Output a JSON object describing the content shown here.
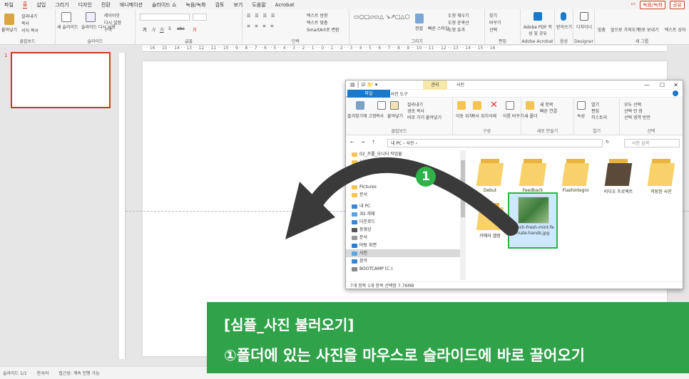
{
  "menu": {
    "items": [
      "파일",
      "홈",
      "삽입",
      "그리기",
      "디자인",
      "전환",
      "애니메이션",
      "슬라이드 쇼",
      "녹음/녹화",
      "검토",
      "보기",
      "도움말",
      "Acrobat"
    ],
    "record_label": "녹음/녹화",
    "share_label": "공유"
  },
  "ribbon": {
    "groups": [
      {
        "label": "클립보드",
        "items": [
          "붙여넣기",
          "잘라내기",
          "복사",
          "서식 복사"
        ]
      },
      {
        "label": "슬라이드",
        "items": [
          "새 슬라이드",
          "슬라이드 다시 사용",
          "레이아웃",
          "다시 설정",
          "구역"
        ]
      },
      {
        "label": "글꼴",
        "items": [
          "가",
          "가",
          "가",
          "S",
          "abc",
          "가"
        ]
      },
      {
        "label": "단락",
        "items": [
          "텍스트 방향",
          "텍스트 맞춤",
          "SmartArt로 변환"
        ]
      },
      {
        "label": "그리기",
        "items": [
          "정렬",
          "빠른 스타일",
          "도형 채우기",
          "도형 윤곽선",
          "도형 효과"
        ]
      },
      {
        "label": "편집",
        "items": [
          "찾기",
          "바꾸기",
          "선택"
        ]
      },
      {
        "label": "Adobe Acrobat",
        "items": [
          "Adobe PDF 작성 및 공유"
        ]
      },
      {
        "label": "음성",
        "items": [
          "받아쓰기"
        ]
      },
      {
        "label": "Designer",
        "items": [
          "디자이너"
        ]
      },
      {
        "label": "새 그룹",
        "items": [
          "맞춤",
          "앞으로 가져오기",
          "뒤로 보내기",
          "텍스트 상자"
        ]
      }
    ]
  },
  "ruler_text": "· 16 · · 15 · · 14 · · 13 · · 12 · · 11 · · 10 · · 9 · · 8 · · 7 · · 6 · · 5 · · 4 · · 3 · · 2 · · 1 · · 0 · · 1 · · 2 · · 3 · · 4 · · 5 · · 6 · · 7 · · 8 · · 9 · · 10 · · 11 · · 12 · · 13 · · 14 · · 15 · · 16 ·",
  "thumbnails": {
    "slide_number": "1"
  },
  "status": {
    "slide_info": "슬라이드 1/1",
    "language": "한국어",
    "accessibility": "접근성: 계속 진행 가능"
  },
  "explorer": {
    "context_tab": "관리",
    "title": "사진",
    "tabs": [
      "파일",
      "홈",
      "공유",
      "보기",
      "사진 도구"
    ],
    "ribbon_groups": [
      {
        "label": "클립보드",
        "items": [
          "즐겨찾기에 고정",
          "복사",
          "붙여넣기",
          "잘라내기",
          "경로 복사",
          "바로 가기 붙여넣기"
        ]
      },
      {
        "label": "구성",
        "items": [
          "이동 위치",
          "복사 위치",
          "삭제",
          "이름 바꾸기"
        ]
      },
      {
        "label": "새로 만들기",
        "items": [
          "새 폴더",
          "새 항목",
          "빠른 연결"
        ]
      },
      {
        "label": "열기",
        "items": [
          "속성",
          "열기",
          "편집",
          "히스토리"
        ]
      },
      {
        "label": "선택",
        "items": [
          "모두 선택",
          "선택 안 함",
          "선택 영역 반전"
        ]
      }
    ],
    "address": "내 PC  ›  사진  ›",
    "search_placeholder": "사진 검색",
    "nav_items": [
      {
        "label": "02_프롤_모니터 작업물",
        "type": "folder"
      },
      {
        "label": "11강_문장 기초 쓸기",
        "type": "folder"
      },
      {
        "label": "20230306_blue color 5월평",
        "type": "folder"
      },
      {
        "label": "Pictures",
        "type": "folder"
      },
      {
        "label": "문서",
        "type": "folder"
      },
      {
        "label": "내 PC",
        "type": "pc"
      },
      {
        "label": "3D 개체",
        "type": "cube"
      },
      {
        "label": "다운로드",
        "type": "download"
      },
      {
        "label": "동영상",
        "type": "video"
      },
      {
        "label": "문서",
        "type": "doc"
      },
      {
        "label": "바탕 화면",
        "type": "desktop"
      },
      {
        "label": "사진",
        "type": "photo"
      },
      {
        "label": "음악",
        "type": "music"
      },
      {
        "label": "BOOTCAMP (C:)",
        "type": "drive"
      }
    ],
    "files": [
      {
        "name": "Debut"
      },
      {
        "name": "Feedback"
      },
      {
        "name": "Flashintegro"
      },
      {
        "name": "비디오 프로젝트"
      },
      {
        "name": "저장된 사진"
      },
      {
        "name": "카메라 앨범"
      },
      {
        "name": "bunch-fresh-mint-female-hands.jpg"
      }
    ],
    "status": "7개 항목    1개 항목 선택함 7.76MB"
  },
  "annotation": {
    "step": "1"
  },
  "caption": {
    "title": "[심플_사진 불러오기]",
    "text": "①폴더에 있는 사진을 마우스로 슬라이드에 바로 끌어오기"
  },
  "colors": {
    "accent": "#c43e1c",
    "green": "#30a34a",
    "highlight": "#2db34a",
    "explorer_blue": "#1979ca"
  }
}
